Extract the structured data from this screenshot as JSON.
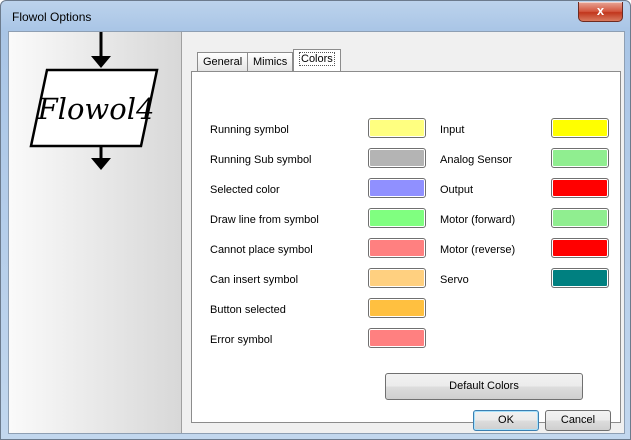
{
  "window": {
    "title": "Flowol Options",
    "close_glyph": "x"
  },
  "sidebar": {
    "logo_text": "Flowol4"
  },
  "tabs": [
    {
      "label": "General",
      "active": false
    },
    {
      "label": "Mimics",
      "active": false
    },
    {
      "label": "Colors",
      "active": true
    }
  ],
  "colors": {
    "left": [
      {
        "label": "Running symbol",
        "color": "#FFFF80"
      },
      {
        "label": "Running Sub symbol",
        "color": "#B4B4B4"
      },
      {
        "label": "Selected color",
        "color": "#9090FF"
      },
      {
        "label": "Draw line from symbol",
        "color": "#80FF80"
      },
      {
        "label": "Cannot place symbol",
        "color": "#FF8080"
      },
      {
        "label": "Can insert symbol",
        "color": "#FFD080"
      },
      {
        "label": "Button selected",
        "color": "#FFC040"
      },
      {
        "label": "Error symbol",
        "color": "#FF8080"
      }
    ],
    "right": [
      {
        "label": "Input",
        "color": "#FFFF00"
      },
      {
        "label": "Analog Sensor",
        "color": "#90EE90"
      },
      {
        "label": "Output",
        "color": "#FF0000"
      },
      {
        "label": "Motor (forward)",
        "color": "#90EE90"
      },
      {
        "label": "Motor (reverse)",
        "color": "#FF0000"
      },
      {
        "label": "Servo",
        "color": "#008080"
      }
    ]
  },
  "buttons": {
    "default_colors": "Default Colors",
    "ok": "OK",
    "cancel": "Cancel"
  }
}
